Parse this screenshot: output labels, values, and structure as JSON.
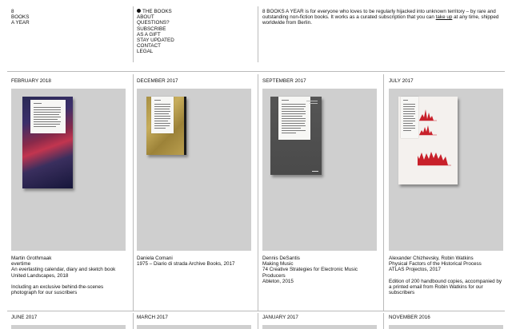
{
  "logo": {
    "lines": [
      "8",
      "BOOKS",
      "A YEAR"
    ]
  },
  "nav": {
    "items": [
      {
        "label": "THE BOOKS",
        "active": true
      },
      {
        "label": "ABOUT"
      },
      {
        "label": "QUESTIONS?"
      },
      {
        "label": "SUBSCRIBE"
      },
      {
        "label": "AS A GIFT"
      },
      {
        "label": "STAY UPDATED"
      },
      {
        "label": "CONTACT"
      },
      {
        "label": "LEGAL"
      }
    ]
  },
  "intro": {
    "line1": "8 BOOKS A YEAR is for everyone who loves to be regularly hijacked into unknown territory – by rare and",
    "line2_pre": "outstanding non-fiction books. It works as a curated subscription that you can ",
    "line2_link": "take up",
    "line2_post": " at any time, shipped",
    "line3": "worldwide from Berlin."
  },
  "books": [
    {
      "date": "FEBRUARY 2018",
      "lines": [
        "Martin Grothmaak",
        "evertime",
        "An everlasting calendar, diary and sketch book",
        "United Landscapes, 2018",
        "",
        "Including an exclusive behind-the-scenes",
        "photograph for our suscribers"
      ]
    },
    {
      "date": "DECEMBER 2017",
      "lines": [
        "Daniela Comani",
        "1975 – Diario di strada Archive Books, 2017"
      ]
    },
    {
      "date": "SEPTEMBER 2017",
      "lines": [
        "Dennis DeSantis",
        "Making Music",
        "74 Creative Strategies for Electronic Music",
        "Producers",
        "Ableton, 2015"
      ]
    },
    {
      "date": "JULY 2017",
      "lines": [
        "Alexander Chizhevsky, Robin Watkins",
        "Physical Factors of the Historical Process",
        "ATLAS Projectos, 2017",
        "",
        "Edition of 200 handbound copies, accompanied by",
        "a printed email from Robin Watkins for our",
        "subscribers"
      ]
    }
  ],
  "next_row": [
    "JUNE 2017",
    "MARCH 2017",
    "JANUARY 2017",
    "NOVEMBER 2016"
  ],
  "colors": {
    "placeholder": "#cfcfcf",
    "rule": "#bbbbbb",
    "text": "#111111"
  }
}
